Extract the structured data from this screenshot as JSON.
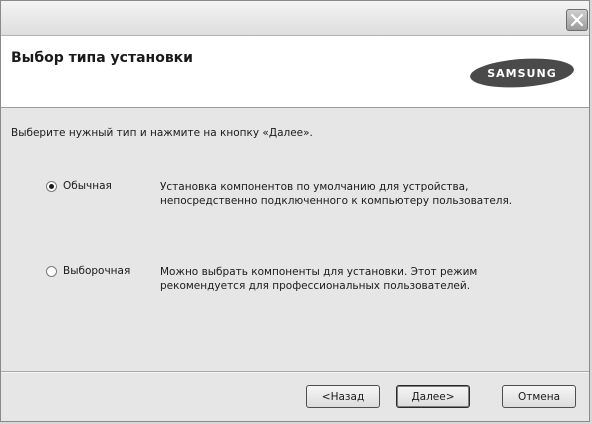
{
  "header": {
    "title": "Выбор типа установки",
    "logo_text": "SAMSUNG"
  },
  "instruction": "Выберите нужный тип и нажмите на кнопку «Далее».",
  "options": [
    {
      "label": "Обычная",
      "selected": true,
      "description_line1": "Установка компонентов по умолчанию для устройства,",
      "description_line2": "непосредственно подключенного к компьютеру пользователя."
    },
    {
      "label": "Выборочная",
      "selected": false,
      "description_line1": "Можно выбрать компоненты для установки. Этот режим",
      "description_line2": "рекомендуется для профессиональных пользователей."
    }
  ],
  "buttons": {
    "back": "<Назад",
    "next": "Далее>",
    "cancel": "Отмена"
  },
  "icons": {
    "close": "close-icon",
    "logo": "samsung-logo"
  },
  "colors": {
    "header_background": "#ffffff",
    "dialog_background": "#e6e6e6",
    "logo_fill": "#4a4a4a"
  }
}
